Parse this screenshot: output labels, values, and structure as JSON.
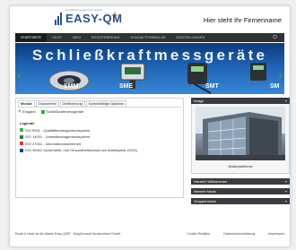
{
  "header": {
    "logo_tagline": "Qualitätsmanagementsystem",
    "logo_name": "EASY-QM",
    "logo_plus": "+",
    "firm_name": "Hier steht Ihr Firmenname"
  },
  "nav": {
    "items": [
      "STARTSEITE",
      "HILFE",
      "INFO",
      "REGISTRIERUNG",
      "KONTAKTFORMULAR",
      "EINSTELLUNGEN"
    ],
    "active_index": 0
  },
  "banner": {
    "title": "Schließkraftmessgeräte",
    "products": [
      "SMM",
      "SME",
      "SMT",
      "SM"
    ],
    "prev_icon": "chevron-left-icon",
    "next_icon": "chevron-right-icon"
  },
  "tabs": {
    "items": [
      "Module",
      "Dokumente",
      "Zertifizierung",
      "Kontextfähige Optionen"
    ],
    "active_index": 0
  },
  "toolbar": {
    "add_label": "Eingabe",
    "view_label": "Schließkraftmessgeräte"
  },
  "legend": {
    "title": "Legende",
    "items": [
      {
        "color": "#4caf50",
        "label": "ISO 9001 - Qualitätsmanagementsystem"
      },
      {
        "color": "#2e7d32",
        "label": "ISO 14001 - Umweltmanagementsystem"
      },
      {
        "color": "#e53935",
        "label": "ISO 27001 - Informationssicherheit"
      },
      {
        "color": "#1e3f8f",
        "label": "ISO 45001 Sicherheits- und Gesundheitsschutz am Arbeitsplatz (SGA)"
      }
    ]
  },
  "sidebar": {
    "image_header": "Image",
    "image_caption": "Musterplattforme",
    "sections": [
      "Herzlich Willkommen",
      "Interner News",
      "Gruppennews"
    ]
  },
  "footer": {
    "copyright": "Email & Notiz ist die Marke Easy-QM® · EasyConsult Deutschland GmbH",
    "links": [
      "Cookie Richtline",
      "Datenschutzerklärung",
      "Impressum"
    ]
  },
  "colors": {
    "nav_bg": "#2f3134",
    "banner_blue": "#1e63b5",
    "accent_green": "#3aa336",
    "sidebar_header": "#3a3c3f"
  }
}
